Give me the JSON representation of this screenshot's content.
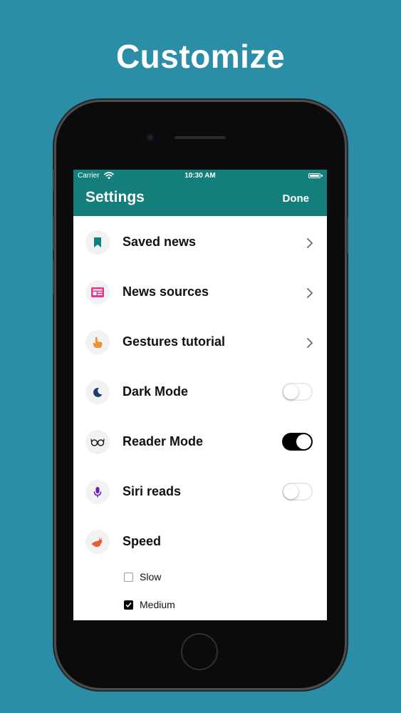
{
  "headline": "Customize",
  "status_bar": {
    "carrier": "Carrier",
    "time": "10:30 AM"
  },
  "navbar": {
    "title": "Settings",
    "done_label": "Done",
    "color": "#147f7a"
  },
  "settings": [
    {
      "label": "Saved news",
      "icon": "bookmark-icon",
      "accessory": "chevron"
    },
    {
      "label": "News sources",
      "icon": "newspaper-icon",
      "accessory": "chevron"
    },
    {
      "label": "Gestures tutorial",
      "icon": "hand-pointer-icon",
      "accessory": "chevron"
    },
    {
      "label": "Dark Mode",
      "icon": "moon-icon",
      "accessory": "toggle",
      "on": false
    },
    {
      "label": "Reader Mode",
      "icon": "glasses-icon",
      "accessory": "toggle",
      "on": true
    },
    {
      "label": "Siri reads",
      "icon": "microphone-icon",
      "accessory": "toggle",
      "on": false
    },
    {
      "label": "Speed",
      "icon": "rabbit-icon",
      "accessory": "none"
    }
  ],
  "speed_options": [
    {
      "label": "Slow",
      "checked": false
    },
    {
      "label": "Medium",
      "checked": true
    }
  ],
  "colors": {
    "background": "#2b8ea6",
    "toggle_on": "#000000"
  }
}
